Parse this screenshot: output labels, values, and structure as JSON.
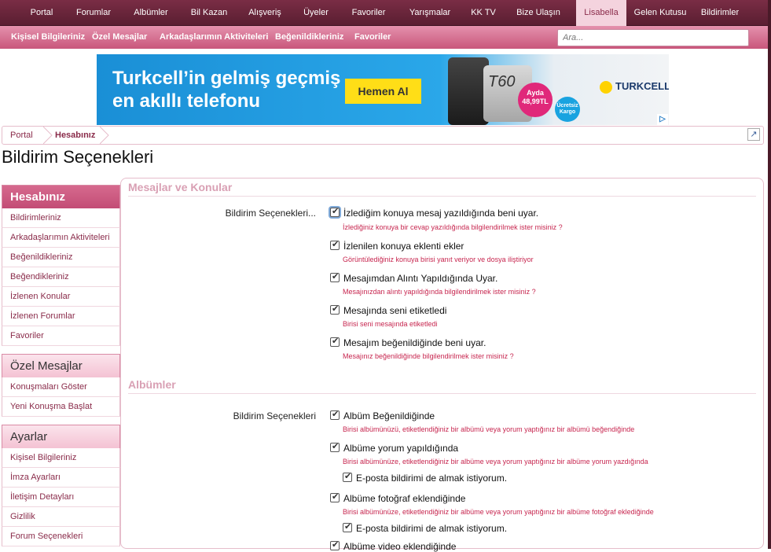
{
  "topnav": {
    "items": [
      "Portal",
      "Forumlar",
      "Albümler",
      "Bil Kazan",
      "Alışveriş",
      "Üyeler",
      "Favoriler",
      "Yarışmalar",
      "KK TV",
      "Bize Ulaşın",
      "Lisabella",
      "Gelen Kutusu",
      "Bildirimler"
    ],
    "active_index": 10
  },
  "subnav": {
    "items": [
      "Kişisel Bilgileriniz",
      "Özel Mesajlar",
      "Arkadaşlarımın Aktiviteleri",
      "Beğenildikleriniz",
      "Favoriler"
    ],
    "search_placeholder": "Ara..."
  },
  "banner": {
    "headline_line1": "Turkcell’in gelmiş geçmiş",
    "headline_line2": "en akıllı telefonu",
    "button": "Hemen Al",
    "model": "T60",
    "price_line1": "Ayda",
    "price_line2": "48,99TL",
    "cargo_line1": "Ücretsiz",
    "cargo_line2": "Kargo",
    "brand": "TURKCELL"
  },
  "breadcrumb": [
    "Portal",
    "Hesabınız"
  ],
  "page_title": "Bildirim Seçenekleri",
  "sidebar": {
    "sections": [
      {
        "title": "Hesabınız",
        "items": [
          "Bildirimleriniz",
          "Arkadaşlarımın Aktiviteleri",
          "Beğenildikleriniz",
          "Beğendikleriniz",
          "İzlenen Konular",
          "İzlenen Forumlar",
          "Favoriler"
        ]
      },
      {
        "title": "Özel Mesajlar",
        "items": [
          "Konuşmaları Göster",
          "Yeni Konuşma Başlat"
        ]
      },
      {
        "title": "Ayarlar",
        "items": [
          "Kişisel Bilgileriniz",
          "İmza Ayarları",
          "İletişim Detayları",
          "Gizlilik",
          "Forum Seçenekleri"
        ]
      }
    ]
  },
  "main": {
    "sections": [
      {
        "title": "Mesajlar ve Konular",
        "label": "Bildirim Seçenekleri...",
        "options": [
          {
            "label": "İzlediğim konuya mesaj yazıldığında beni uyar.",
            "hint": "İzlediğiniz konuya bir cevap yazıldığında bilgilendirilmek ister misiniz ?",
            "checked": true
          },
          {
            "label": "İzlenilen konuya eklenti ekler",
            "hint": "Görüntülediğiniz konuya birisi yanıt veriyor ve dosya iliştiriyor",
            "checked": true
          },
          {
            "label": "Mesajımdan Alıntı Yapıldığında Uyar.",
            "hint": "Mesajınızdan alıntı yapıldığında bilgilendirilmek ister misiniz ?",
            "checked": true
          },
          {
            "label": "Mesajında seni etiketledi",
            "hint": "Birisi seni mesajında etiketledi",
            "checked": true
          },
          {
            "label": "Mesajım beğenildiğinde beni uyar.",
            "hint": "Mesajınız beğenildiğinde bilgilendirilmek ister misiniz ?",
            "checked": true
          }
        ]
      },
      {
        "title": "Albümler",
        "label": "Bildirim Seçenekleri",
        "options": [
          {
            "label": "Albüm Beğenildiğinde",
            "hint": "Birisi albümünüzü, etiketlendiğiniz bir albümü veya yorum yaptığınız bir albümü beğendiğinde",
            "checked": true
          },
          {
            "label": "Albüme yorum yapıldığında",
            "hint": "Birisi albümünüze, etiketlendiğiniz bir albüme veya yorum yaptığınız bir albüme yorum yazdığında",
            "checked": true
          },
          {
            "label": "E-posta bildirimi de almak istiyorum.",
            "hint": "",
            "checked": true
          },
          {
            "label": "Albüme fotoğraf eklendiğinde",
            "hint": "Birisi albümünüze, etiketlendiğiniz bir albüme veya yorum yaptığınız bir albüme fotoğraf eklediğinde",
            "checked": true
          },
          {
            "label": "E-posta bildirimi de almak istiyorum.",
            "hint": "",
            "checked": true
          },
          {
            "label": "Albüme video eklendiğinde",
            "hint": "",
            "checked": true
          }
        ]
      }
    ]
  }
}
